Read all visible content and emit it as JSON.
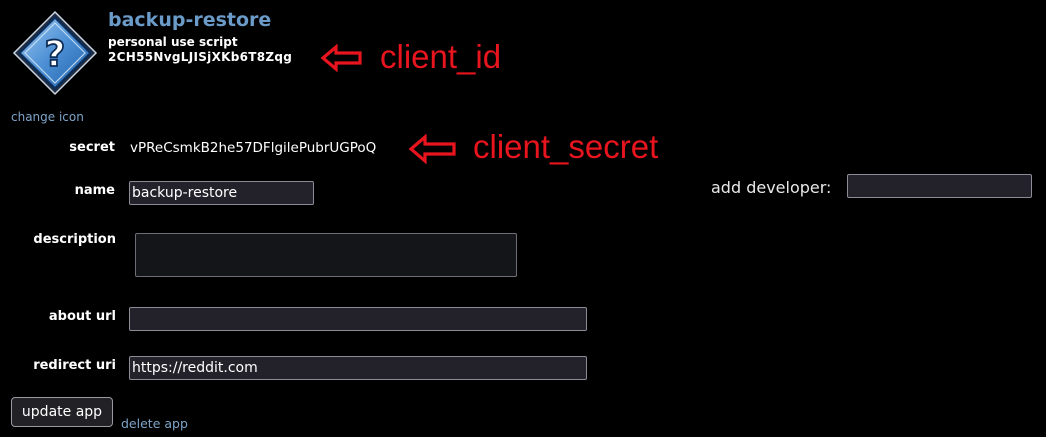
{
  "app": {
    "title": "backup-restore",
    "type": "personal use script",
    "client_id": "2CH55NvgLJISjXKb6T8Zqg",
    "change_icon_label": "change icon"
  },
  "annotations": {
    "client_id_label": "client_id",
    "client_secret_label": "client_secret",
    "color": "#e8141e"
  },
  "form": {
    "secret_label": "secret",
    "secret_value": "vPReCsmkB2he57DFlgilePubrUGPoQ",
    "name_label": "name",
    "name_value": "backup-restore",
    "description_label": "description",
    "description_value": "",
    "about_url_label": "about url",
    "about_url_value": "",
    "redirect_uri_label": "redirect uri",
    "redirect_uri_value": "https://reddit.com",
    "add_developer_label": "add developer:",
    "add_developer_value": ""
  },
  "actions": {
    "update_label": "update app",
    "delete_label": "delete app"
  },
  "icons": {
    "app_icon": "question-diamond-icon",
    "arrow": "left-arrow-icon"
  }
}
